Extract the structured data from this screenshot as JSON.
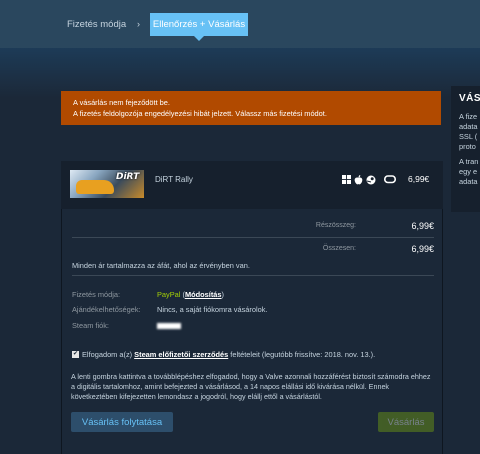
{
  "breadcrumb": {
    "step1": "Fizetés módja",
    "arrow": "›",
    "step2": "Ellenőrzés + Vásárlás"
  },
  "error": {
    "line1": "A vásárlás nem fejeződött be.",
    "line2": "A fizetés feldolgozója engedélyezési hibát jelzett. Válassz más fizetési módot."
  },
  "sidebar": {
    "title": "VÁS",
    "block1": [
      "A fize",
      "adata",
      "SSL (",
      "proto"
    ],
    "block2": [
      "A tran",
      "egy e",
      "adata"
    ]
  },
  "cart": {
    "image_logo": "DiRT",
    "game_name": "DiRT Rally",
    "platform_icons": [
      "windows-icon",
      "apple-icon",
      "steam-icon",
      "steamvr-icon"
    ],
    "price": "6,99€"
  },
  "summary": {
    "subtotal_label": "Részösszeg:",
    "subtotal_value": "6,99€",
    "total_label": "Összesen:",
    "total_value": "6,99€",
    "vat_note": "Minden ár tartalmazza az áfát, ahol az érvényben van."
  },
  "details": {
    "payment_label": "Fizetés módja:",
    "payment_value": "PayPal",
    "payment_open": "(",
    "payment_modify": "Módosítás",
    "payment_close": ")",
    "gift_label": "Ajándékelhetőségek:",
    "gift_value": "Nincs, a saját fiókomra vásárolok.",
    "account_label": "Steam fiók:"
  },
  "agreement": {
    "checked": true,
    "prefix": "Elfogadom a(z) ",
    "link": "Steam előfizetői szerződés",
    "suffix": " feltételeit (legutóbb frissítve: 2018. nov. 13.)."
  },
  "legal_text": "A lenti gombra kattintva a továbblépéshez elfogadod, hogy a Valve azonnali hozzáférést biztosít számodra ehhez a digitális tartalomhoz, amint befejezted a vásárlásod, a 14 napos elállási idő kivárása nélkül. Ennek következtében kifejezetten lemondasz a jogodról, hogy elállj ettől a vásárlástól.",
  "buttons": {
    "continue": "Vásárlás folytatása",
    "purchase": "Vásárlás"
  },
  "colors": {
    "background": "#1b2838",
    "error": "#b14a00",
    "accent": "#67c1f5",
    "paypal": "#a4d007"
  }
}
